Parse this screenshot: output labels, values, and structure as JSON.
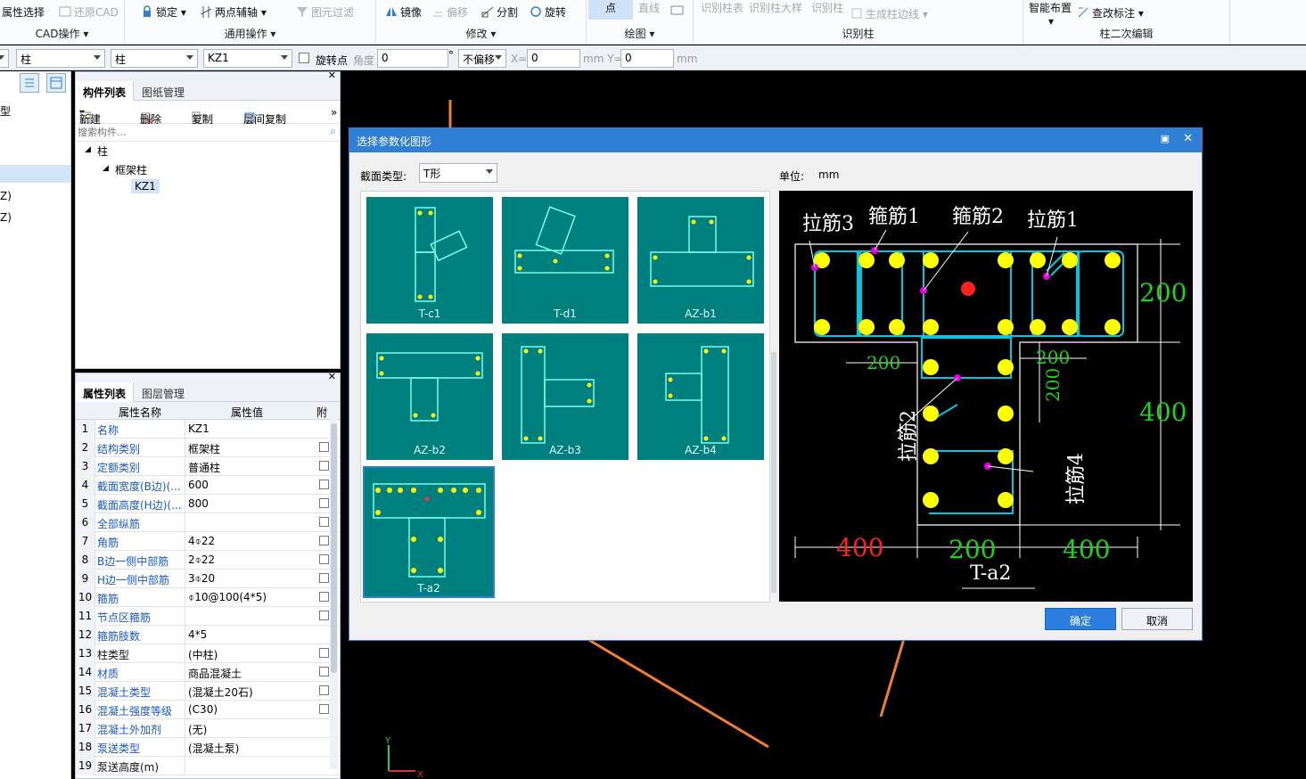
{
  "ribbon": {
    "groups": [
      {
        "label": "CAD操作",
        "buttons": [
          "属性选择",
          "还原CAD"
        ]
      },
      {
        "label": "通用操作",
        "buttons": [
          "锁定",
          "两点辅轴",
          "图元过滤"
        ]
      },
      {
        "label": "修改",
        "buttons": [
          "镜像",
          "偏移",
          "分割",
          "旋转"
        ]
      },
      {
        "label": "绘图",
        "buttons": [
          "点",
          "直线"
        ]
      },
      {
        "label": "识别柱",
        "buttons": [
          "识别柱表",
          "识别柱大样",
          "识别柱",
          "生成柱边线"
        ]
      },
      {
        "label": "柱二次编辑",
        "buttons": [
          "智能布置",
          "查改标注"
        ]
      }
    ]
  },
  "optionsbar": {
    "select1": "柱",
    "select2": "柱",
    "select3": "KZ1",
    "rotate_point_label": "旋转点",
    "angle_label": "角度",
    "angle_value": "0",
    "degree": "°",
    "offset_select": "不偏移",
    "x_label": "X=",
    "x_value": "0",
    "y_label": "mm Y=",
    "y_value": "0",
    "mm": "mm"
  },
  "left_strip": {
    "items": [
      "型",
      "Z)",
      "Z)"
    ]
  },
  "component_panel": {
    "tabs": [
      "构件列表",
      "图纸管理"
    ],
    "toolbar": [
      "新建",
      "删除",
      "复制",
      "层间复制"
    ],
    "search_placeholder": "搜索构件...",
    "tree": [
      "柱",
      "框架柱",
      "KZ1"
    ]
  },
  "property_panel": {
    "tabs": [
      "属性列表",
      "图层管理"
    ],
    "headers": [
      "属性名称",
      "属性值",
      "附"
    ],
    "rows": [
      {
        "num": "1",
        "name": "名称",
        "value": "KZ1",
        "blue": true,
        "check": false
      },
      {
        "num": "2",
        "name": "结构类别",
        "value": "框架柱",
        "blue": true,
        "check": true
      },
      {
        "num": "3",
        "name": "定额类别",
        "value": "普通柱",
        "blue": true,
        "check": true
      },
      {
        "num": "4",
        "name": "截面宽度(B边)(...",
        "value": "600",
        "blue": true,
        "check": true
      },
      {
        "num": "5",
        "name": "截面高度(H边)(...",
        "value": "800",
        "blue": true,
        "check": true
      },
      {
        "num": "6",
        "name": "全部纵筋",
        "value": "",
        "blue": true,
        "check": true
      },
      {
        "num": "7",
        "name": "角筋",
        "value": "4⌽22",
        "blue": true,
        "check": true
      },
      {
        "num": "8",
        "name": "B边一侧中部筋",
        "value": "2⌽22",
        "blue": true,
        "check": true
      },
      {
        "num": "9",
        "name": "H边一侧中部筋",
        "value": "3⌽20",
        "blue": true,
        "check": true
      },
      {
        "num": "10",
        "name": "箍筋",
        "value": "⌽10@100(4*5)",
        "blue": true,
        "check": true
      },
      {
        "num": "11",
        "name": "节点区箍筋",
        "value": "",
        "blue": true,
        "check": true
      },
      {
        "num": "12",
        "name": "箍筋肢数",
        "value": "4*5",
        "blue": true,
        "check": false
      },
      {
        "num": "13",
        "name": "柱类型",
        "value": "(中柱)",
        "blue": false,
        "check": true
      },
      {
        "num": "14",
        "name": "材质",
        "value": "商品混凝土",
        "blue": true,
        "check": true
      },
      {
        "num": "15",
        "name": "混凝土类型",
        "value": "(混凝土20石)",
        "blue": true,
        "check": true
      },
      {
        "num": "16",
        "name": "混凝土强度等级",
        "value": "(C30)",
        "blue": true,
        "check": true
      },
      {
        "num": "17",
        "name": "混凝土外加剂",
        "value": "(无)",
        "blue": true,
        "check": false
      },
      {
        "num": "18",
        "name": "泵送类型",
        "value": "(混凝土泵)",
        "blue": true,
        "check": false
      },
      {
        "num": "19",
        "name": "泵送高度(m)",
        "value": "",
        "blue": false,
        "check": false
      }
    ]
  },
  "dialog": {
    "title": "选择参数化图形",
    "section_label": "截面类型:",
    "section_value": "T形",
    "unit_label": "单位:",
    "unit_value": "mm",
    "thumbs": [
      "T-c1",
      "T-d1",
      "AZ-b1",
      "AZ-b2",
      "AZ-b3",
      "AZ-b4",
      "T-a2"
    ],
    "ok": "确定",
    "cancel": "取消"
  },
  "preview": {
    "name": "T-a2",
    "labels": [
      "拉筋3",
      "箍筋1",
      "箍筋2",
      "拉筋1",
      "拉筋2",
      "拉筋4"
    ],
    "dims": [
      "200",
      "400",
      "200",
      "200",
      "200",
      "400",
      "200",
      "400"
    ]
  },
  "colors": {
    "accent": "#2f7fd4",
    "teal": "#007f7f",
    "rebar": "#ffff00",
    "stirrup": "#00c8e0",
    "orange": "#f08030"
  }
}
